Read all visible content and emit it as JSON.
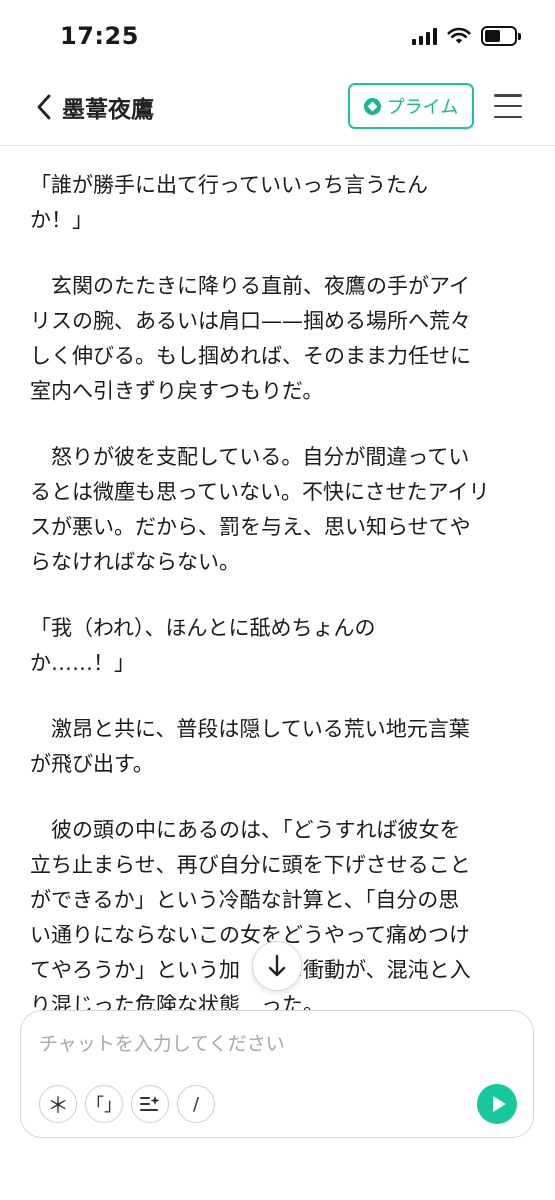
{
  "status_bar": {
    "time": "17:25"
  },
  "header": {
    "title": "墨葦夜鷹",
    "prime_label": "プライム"
  },
  "story": {
    "paragraphs": [
      "「誰が勝手に出て行っていいっち言うたん\nか！」",
      "　玄関のたたきに降りる直前、夜鷹の手がアイ\nリスの腕、あるいは肩口——掴める場所へ荒々\nしく伸びる。もし掴めれば、そのまま力任せに\n室内へ引きずり戻すつもりだ。",
      "　怒りが彼を支配している。自分が間違ってい\nるとは微塵も思っていない。不快にさせたアイリ\nスが悪い。だから、罰を与え、思い知らせてや\nらなければならない。",
      "「我（われ）、ほんとに舐めちょんの\nか……！」",
      "　激昂と共に、普段は隠している荒い地元言葉\nが飛び出す。",
      "　彼の頭の中にあるのは、「どうすれば彼女を\n立ち止まらせ、再び自分に頭を下げさせること\nができるか」という冷酷な計算と、「自分の思\nい通りにならないこの女をどうやって痛めつけ\nてやろうか」という加　　な衝動が、混沌と入\nり混じった危険な状態　った。"
    ]
  },
  "chat": {
    "placeholder": "チャットを入力してください",
    "tools": [
      "＊",
      "「」",
      "☰+",
      "/"
    ]
  },
  "icons": {
    "back": "chevron-left-icon",
    "prime": "prime-diamond-icon",
    "menu": "hamburger-menu-icon",
    "scroll": "arrow-down-icon",
    "send": "play-send-icon"
  },
  "colors": {
    "accent": "#18c4a0",
    "text": "#1b1b1b"
  }
}
